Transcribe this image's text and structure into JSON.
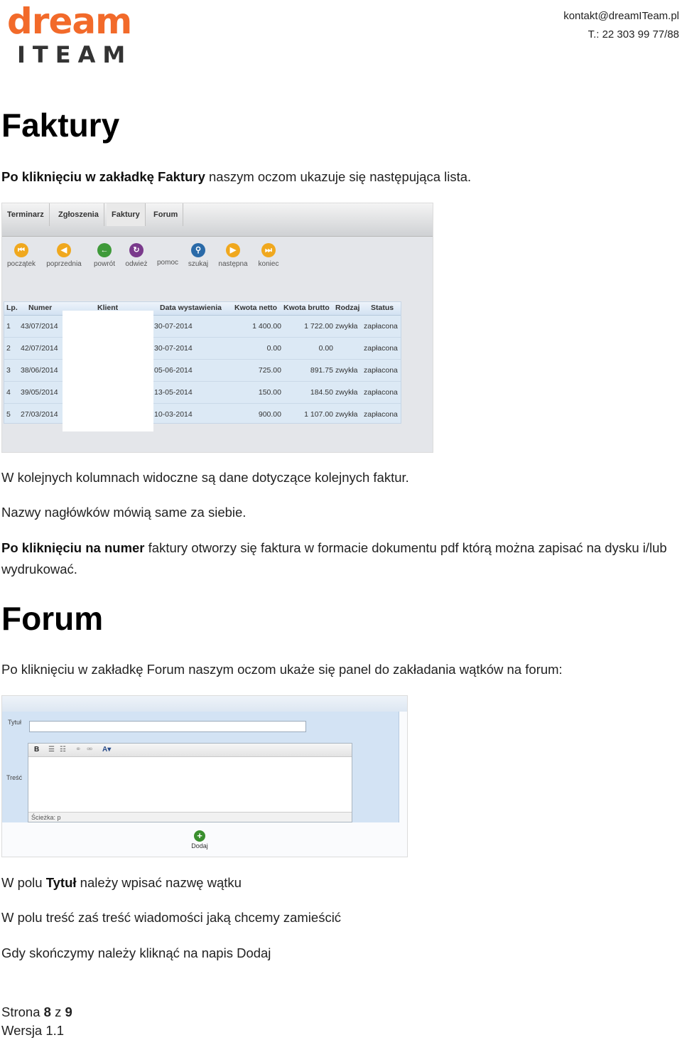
{
  "header": {
    "logo_word1": "dream",
    "logo_word2": "ITEAM",
    "email": "kontakt@dreamITeam.pl",
    "phone": "T.: 22 303 99 77/88"
  },
  "section_faktury": {
    "title": "Faktury",
    "intro_bold": "Po kliknięciu w zakładkę Faktury",
    "intro_rest": " naszym oczom ukazuje się następująca lista.",
    "p1": "W kolejnych kolumnach widoczne są dane dotyczące kolejnych faktur.",
    "p2": "Nazwy nagłówków mówią same za siebie.",
    "p3_bold": "Po kliknięciu na numer",
    "p3_rest": " faktury otworzy się faktura w formacie dokumentu pdf którą można zapisać na dysku i/lub wydrukować."
  },
  "invoice_ui": {
    "tabs": [
      "Terminarz",
      "Zgłoszenia",
      "Faktury",
      "Forum"
    ],
    "toolbar": [
      {
        "label": "początek",
        "icon": "first-icon",
        "glyph": "⏮",
        "color": "#f0a81e"
      },
      {
        "label": "poprzednia",
        "icon": "prev-icon",
        "glyph": "◀",
        "color": "#f0a81e"
      },
      {
        "label": "powrót",
        "icon": "back-icon",
        "glyph": "←",
        "color": "#3f9a3a"
      },
      {
        "label": "odwież",
        "icon": "refresh-icon",
        "glyph": "↻",
        "color": "#7a3a8c"
      },
      {
        "label": "pomoc",
        "icon": "help-icon",
        "glyph": "",
        "color": "transparent"
      },
      {
        "label": "szukaj",
        "icon": "search-icon",
        "glyph": "⚲",
        "color": "#2a6aa8"
      },
      {
        "label": "następna",
        "icon": "next-icon",
        "glyph": "▶",
        "color": "#f0a81e"
      },
      {
        "label": "koniec",
        "icon": "last-icon",
        "glyph": "⏭",
        "color": "#f0a81e"
      }
    ],
    "columns": [
      "Lp.",
      "Numer",
      "Klient",
      "Data wystawienia",
      "Kwota netto",
      "Kwota brutto",
      "Rodzaj",
      "Status"
    ],
    "rows": [
      {
        "lp": "1",
        "numer": "43/07/2014",
        "data": "30-07-2014",
        "netto": "1 400.00",
        "brutto": "1 722.00",
        "rodzaj": "zwykła",
        "status": "zapłacona"
      },
      {
        "lp": "2",
        "numer": "42/07/2014",
        "data": "30-07-2014",
        "netto": "0.00",
        "brutto": "0.00",
        "rodzaj": "",
        "status": "zapłacona"
      },
      {
        "lp": "3",
        "numer": "38/06/2014",
        "data": "05-06-2014",
        "netto": "725.00",
        "brutto": "891.75",
        "rodzaj": "zwykła",
        "status": "zapłacona"
      },
      {
        "lp": "4",
        "numer": "39/05/2014",
        "data": "13-05-2014",
        "netto": "150.00",
        "brutto": "184.50",
        "rodzaj": "zwykła",
        "status": "zapłacona"
      },
      {
        "lp": "5",
        "numer": "27/03/2014",
        "data": "10-03-2014",
        "netto": "900.00",
        "brutto": "1 107.00",
        "rodzaj": "zwykła",
        "status": "zapłacona"
      }
    ]
  },
  "section_forum": {
    "title": "Forum",
    "intro": "Po kliknięciu w zakładkę Forum naszym oczom ukaże się panel do zakładania wątków na forum:",
    "l1_pre": "W polu ",
    "l1_bold": "Tytuł",
    "l1_post": " należy wpisać nazwę wątku",
    "l2": "W polu treść zaś treść wiadomości jaką chcemy zamieścić",
    "l3": "Gdy skończymy należy kliknąć na napis Dodaj"
  },
  "forum_ui": {
    "title_label": "Tytuł",
    "content_label": "Treść",
    "toolbar_bold": "B",
    "path_label": "Ścieżka: p",
    "add_label": "Dodaj"
  },
  "footer": {
    "page_prefix": "Strona ",
    "page_num": "8",
    "page_mid": " z ",
    "page_total": "9",
    "version": "Wersja 1.1"
  }
}
